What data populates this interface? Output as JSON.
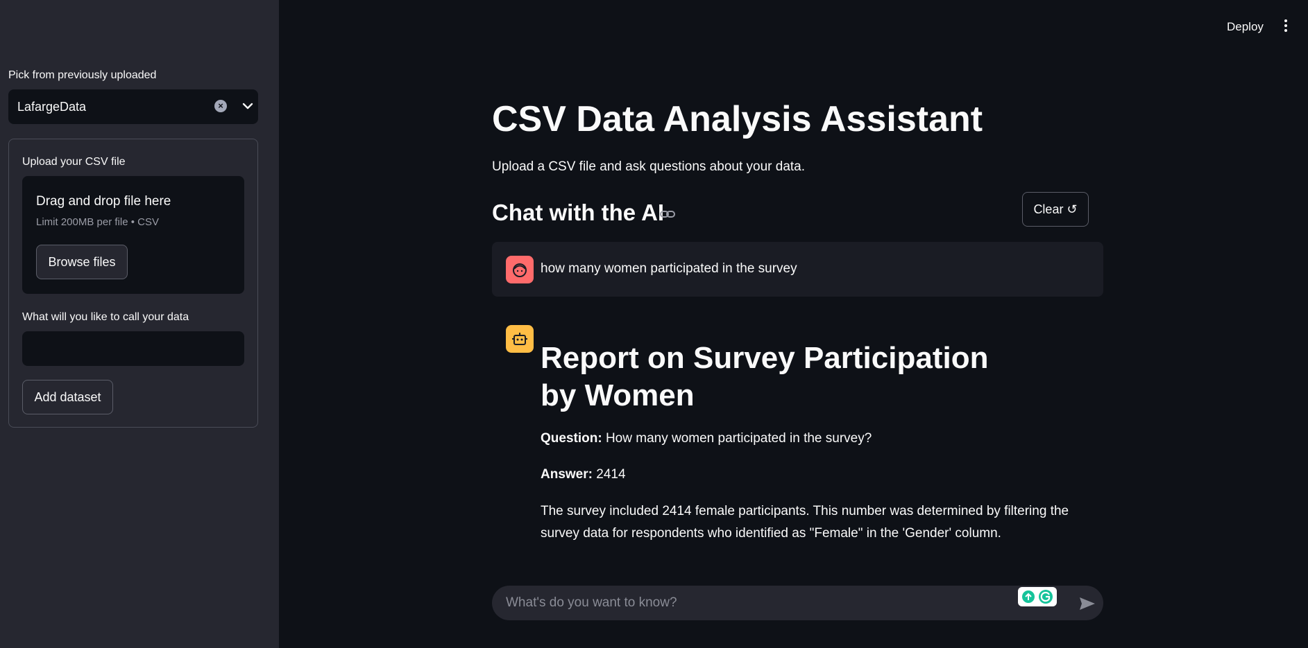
{
  "sidebar": {
    "pick_label": "Pick from previously uploaded",
    "selected_dataset": "LafargeData",
    "upload_label": "Upload your CSV file",
    "dropzone_title": "Drag and drop file here",
    "dropzone_sub": "Limit 200MB per file • CSV",
    "browse_label": "Browse files",
    "name_label": "What will you like to call your data",
    "name_value": "",
    "add_label": "Add dataset"
  },
  "header": {
    "deploy_label": "Deploy",
    "menu_icon": "kebab-menu-icon"
  },
  "main": {
    "title": "CSV Data Analysis Assistant",
    "subtitle": "Upload a CSV file and ask questions about your data.",
    "chat_heading": "Chat with the AI",
    "clear_label": "Clear ↺"
  },
  "messages": {
    "user_text": "how many women participated in the survey",
    "report_title": "Report on Survey Participation by Women",
    "question_label": "Question:",
    "question_text": "How many women participated in the survey?",
    "answer_label": "Answer:",
    "answer_text": "2414",
    "description": "The survey included 2414 female participants. This number was determined by filtering the survey data for respondents who identified as \"Female\" in the 'Gender' column."
  },
  "chat_input": {
    "placeholder": "What's do you want to know?"
  },
  "colors": {
    "background": "#0e1117",
    "sidebar": "#262730",
    "user_avatar": "#ff6b6b",
    "bot_avatar": "#ffbd45"
  }
}
